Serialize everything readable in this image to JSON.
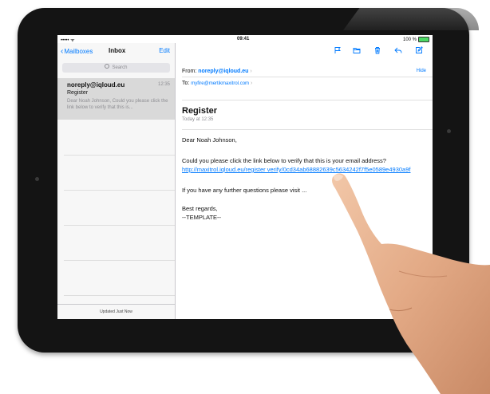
{
  "status_bar": {
    "signal": "•••••  ᯤ",
    "time": "09:41",
    "battery": "100 %"
  },
  "sidebar": {
    "back_label": "Mailboxes",
    "title": "Inbox",
    "edit_label": "Edit",
    "search_placeholder": "Search",
    "messages": [
      {
        "sender": "noreply@iqloud.eu",
        "time": "12:35",
        "subject": "Register",
        "preview": "Dear Noah Johnson, Could you please click the link below to verify that this is..."
      }
    ],
    "footer": "Updated Just Now"
  },
  "toolbar": {
    "icons": [
      "flag-icon",
      "folder-icon",
      "trash-icon",
      "reply-icon",
      "compose-icon"
    ]
  },
  "message": {
    "from_label": "From:",
    "from": "noreply@iqloud.eu",
    "to_label": "To:",
    "to": "myfire@mertikmaxitrol.com",
    "hide_label": "Hide",
    "subject": "Register",
    "date": "Today at 12:35",
    "greeting": "Dear Noah Johnson,",
    "line1": "Could you please click the link below to verify that this is your email address?",
    "link": "http://maxitrol.iqloud.eu/register verify/0cd34ab68882639c5634242f7f5e0589e4930a9f",
    "line2": "If you have any further questions please visit ...",
    "signoff": "Best regards,",
    "signature": "--TEMPLATE--"
  },
  "colors": {
    "accent": "#007aff",
    "bezel": "#141414",
    "selected_row": "#d9d9d9"
  }
}
